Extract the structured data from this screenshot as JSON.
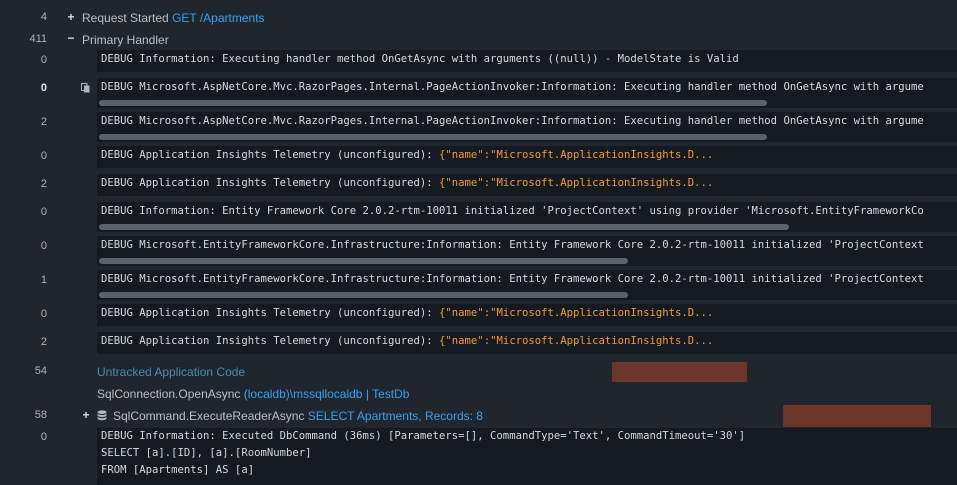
{
  "header": {
    "request_started": {
      "count": "4",
      "label": "Request Started",
      "route": "GET /Apartments"
    },
    "primary_handler": {
      "count": "411",
      "label": "Primary Handler"
    }
  },
  "log_rows": [
    {
      "count": "0",
      "pre": "DEBUG Information: Executing handler method OnGetAsync with arguments ((null)) - ModelState is Valid",
      "post": ""
    },
    {
      "count": "0",
      "pre": "DEBUG Microsoft.AspNetCore.Mvc.RazorPages.Internal.PageActionInvoker:Information: Executing handler method OnGetAsync with argume",
      "post": ""
    },
    {
      "count": "2",
      "pre": "DEBUG Microsoft.AspNetCore.Mvc.RazorPages.Internal.PageActionInvoker:Information: Executing handler method OnGetAsync with argume",
      "post": ""
    },
    {
      "count": "0",
      "pre": "DEBUG Application Insights Telemetry (unconfigured): ",
      "post": "{\"name\":\"Microsoft.ApplicationInsights.D..."
    },
    {
      "count": "2",
      "pre": "DEBUG Application Insights Telemetry (unconfigured): ",
      "post": "{\"name\":\"Microsoft.ApplicationInsights.D..."
    },
    {
      "count": "0",
      "pre": "DEBUG Information: Entity Framework Core 2.0.2-rtm-10011 initialized 'ProjectContext' using provider 'Microsoft.EntityFrameworkCo",
      "post": ""
    },
    {
      "count": "0",
      "pre": "DEBUG Microsoft.EntityFrameworkCore.Infrastructure:Information: Entity Framework Core 2.0.2-rtm-10011 initialized 'ProjectContext",
      "post": ""
    },
    {
      "count": "1",
      "pre": "DEBUG Microsoft.EntityFrameworkCore.Infrastructure:Information: Entity Framework Core 2.0.2-rtm-10011 initialized 'ProjectContext",
      "post": ""
    },
    {
      "count": "0",
      "pre": "DEBUG Application Insights Telemetry (unconfigured): ",
      "post": "{\"name\":\"Microsoft.ApplicationInsights.D..."
    },
    {
      "count": "2",
      "pre": "DEBUG Application Insights Telemetry (unconfigured): ",
      "post": "{\"name\":\"Microsoft.ApplicationInsights.D..."
    }
  ],
  "untracked": {
    "count": "54",
    "label": "Untracked Application Code"
  },
  "sql_connection": {
    "label": "SqlConnection.OpenAsync",
    "server": "(localdb)\\mssqllocaldb",
    "sep": "|",
    "db": "TestDb"
  },
  "sql_command": {
    "count": "58",
    "label": "SqlCommand.ExecuteReaderAsync",
    "query": "SELECT Apartments, Records: 8"
  },
  "final_log": {
    "count": "0",
    "line1": "DEBUG Information: Executed DbCommand (36ms) [Parameters=[], CommandType='Text', CommandTimeout='30']",
    "line2": "SELECT [a].[ID], [a].[RoomNumber]",
    "line3": "FROM [Apartments] AS [a]"
  },
  "colors": {
    "link": "#3aa0f0",
    "json_value": "#f39b2f",
    "background": "#1f262d",
    "log_background": "#141a1f"
  }
}
